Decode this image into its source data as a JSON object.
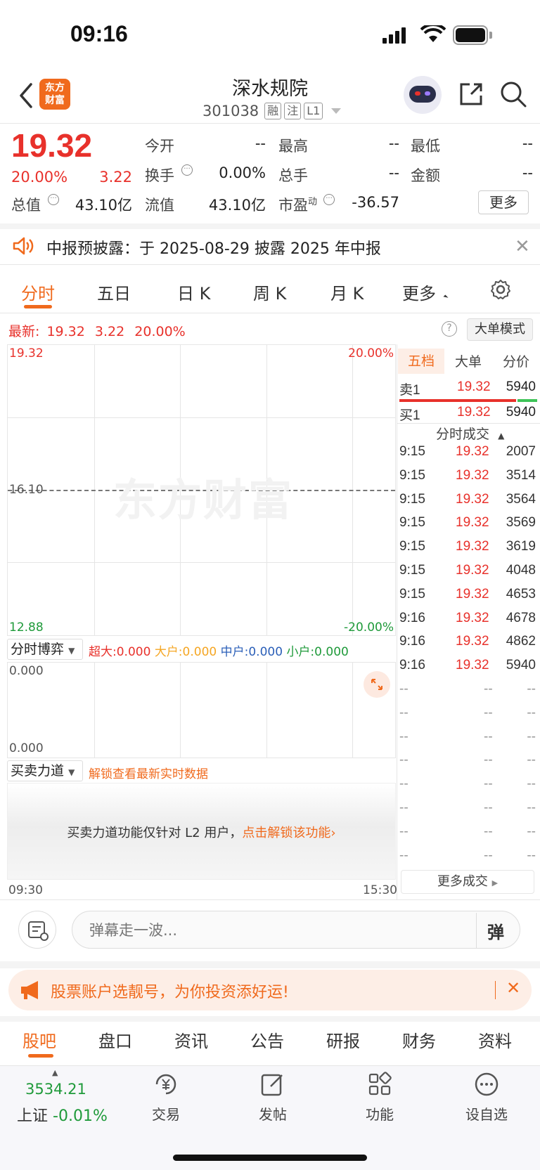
{
  "status_bar": {
    "time": "09:16"
  },
  "header": {
    "stock_name": "深水规院",
    "stock_code": "301038",
    "tags": [
      "融",
      "注",
      "L1"
    ],
    "logo_text_1": "东方",
    "logo_text_2": "财富"
  },
  "quote": {
    "price": "19.32",
    "change_pct": "20.00%",
    "change_amt": "3.22",
    "stats": {
      "open_label": "今开",
      "open_value": "--",
      "high_label": "最高",
      "high_value": "--",
      "low_label": "最低",
      "low_value": "--",
      "turnover_label": "换手",
      "turnover_value": "0.00%",
      "volume_label": "总手",
      "volume_value": "--",
      "amount_label": "金额",
      "amount_value": "--",
      "mktcap_label": "总值",
      "mktcap_value": "43.10亿",
      "float_label": "流值",
      "float_value": "43.10亿",
      "pe_label": "市盈",
      "pe_sup": "动",
      "pe_value": "-36.57",
      "more_button": "更多"
    }
  },
  "notice": {
    "text": "中报预披露：于 2025-08-29 披露 2025 年中报"
  },
  "chart_tabs": {
    "items": [
      "分时",
      "五日",
      "日 K",
      "周 K",
      "月 K",
      "更多"
    ],
    "active": "分时"
  },
  "latest_line": {
    "label": "最新:",
    "price": "19.32",
    "change": "3.22",
    "pct": "20.00%",
    "mode_button": "大单模式"
  },
  "chart": {
    "top_price": "19.32",
    "top_pct": "20.00%",
    "mid_price": "16.10",
    "bottom_price": "12.88",
    "bottom_pct": "-20.00%",
    "watermark": "东方财富",
    "time_start": "09:30",
    "time_end": "15:30"
  },
  "game_panel": {
    "selector": "分时博弈",
    "super_label": "超大:0.000",
    "large_label": "大户:0.000",
    "mid_label": "中户:0.000",
    "small_label": "小户:0.000",
    "top_value": "0.000",
    "bottom_value": "0.000"
  },
  "power_panel": {
    "selector": "买卖力道",
    "unlock_link": "解锁查看最新实时数据",
    "message": "买卖力道功能仅针对 L2 用户，",
    "message_link": "点击解锁该功能"
  },
  "order_book": {
    "tabs": [
      "五档",
      "大单",
      "分价"
    ],
    "ask_label": "卖1",
    "ask_price": "19.32",
    "ask_vol": "5940",
    "bid_label": "买1",
    "bid_price": "19.32",
    "bid_vol": "5940",
    "trades_title": "分时成交",
    "trades": [
      {
        "time": "9:15",
        "price": "19.32",
        "vol": "2007"
      },
      {
        "time": "9:15",
        "price": "19.32",
        "vol": "3514"
      },
      {
        "time": "9:15",
        "price": "19.32",
        "vol": "3564"
      },
      {
        "time": "9:15",
        "price": "19.32",
        "vol": "3569"
      },
      {
        "time": "9:15",
        "price": "19.32",
        "vol": "3619"
      },
      {
        "time": "9:15",
        "price": "19.32",
        "vol": "4048"
      },
      {
        "time": "9:15",
        "price": "19.32",
        "vol": "4653"
      },
      {
        "time": "9:16",
        "price": "19.32",
        "vol": "4678"
      },
      {
        "time": "9:16",
        "price": "19.32",
        "vol": "4862"
      },
      {
        "time": "9:16",
        "price": "19.32",
        "vol": "5940"
      },
      {
        "time": "--",
        "price": "--",
        "vol": "--"
      },
      {
        "time": "--",
        "price": "--",
        "vol": "--"
      },
      {
        "time": "--",
        "price": "--",
        "vol": "--"
      },
      {
        "time": "--",
        "price": "--",
        "vol": "--"
      },
      {
        "time": "--",
        "price": "--",
        "vol": "--"
      },
      {
        "time": "--",
        "price": "--",
        "vol": "--"
      },
      {
        "time": "--",
        "price": "--",
        "vol": "--"
      },
      {
        "time": "--",
        "price": "--",
        "vol": "--"
      }
    ],
    "more_trades": "更多成交"
  },
  "danmaku": {
    "placeholder": "弹幕走一波...",
    "toggle_label": "弹"
  },
  "promo": {
    "text": "股票账户选靓号，为你投资添好运!"
  },
  "bottom_tabs": {
    "items": [
      "股吧",
      "盘口",
      "资讯",
      "公告",
      "研报",
      "财务",
      "资料"
    ],
    "active": "股吧"
  },
  "bottom_nav": {
    "index_value": "3534.21",
    "index_name": "上证",
    "index_change": "-0.01%",
    "trade": "交易",
    "post": "发帖",
    "functions": "功能",
    "watchlist": "设自选"
  },
  "colors": {
    "up": "#e8312b",
    "down": "#1f9a3a",
    "accent": "#f06a1d",
    "blue": "#2b5fb8",
    "yellow": "#f5a623"
  }
}
